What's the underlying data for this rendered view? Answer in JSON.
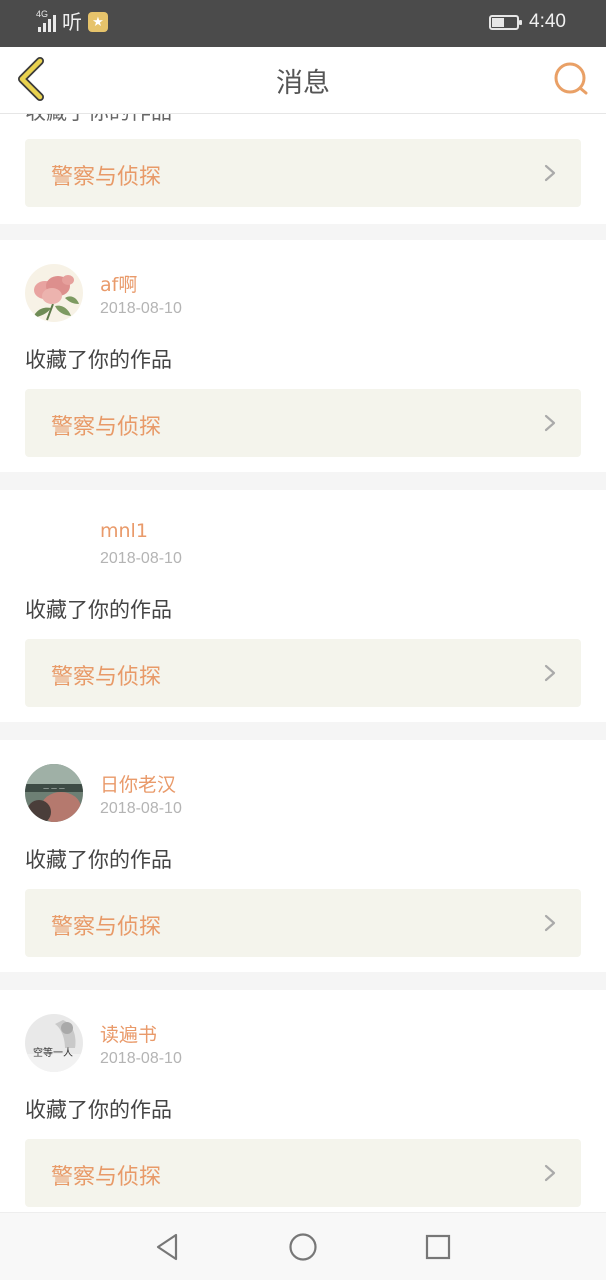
{
  "status_bar": {
    "network": "4G",
    "app_label": "听",
    "time": "4:40",
    "battery_level": 0.45,
    "icons": [
      "signal-icon",
      "ting-app-icon",
      "star-app-icon",
      "battery-icon"
    ]
  },
  "nav": {
    "title": "消息",
    "back_icon": "chevron-left-icon",
    "search_icon": "search-icon",
    "accent_color": "#e9a066",
    "back_color": "#e9d24f"
  },
  "partial_top": {
    "work_title": "警察与侦探"
  },
  "messages": [
    {
      "username": "af啊",
      "date": "2018-08-10",
      "action": "收藏了你的作品",
      "work_title": "警察与侦探",
      "avatar": "flower-avatar"
    },
    {
      "username": "mnl1",
      "date": "2018-08-10",
      "action": "收藏了你的作品",
      "work_title": "警察与侦探",
      "avatar": "blank-avatar"
    },
    {
      "username": "日你老汉",
      "date": "2018-08-10",
      "action": "收藏了你的作品",
      "work_title": "警察与侦探",
      "avatar": "photo-avatar"
    },
    {
      "username": "读遍书",
      "date": "2018-08-10",
      "action": "收藏了你的作品",
      "work_title": "警察与侦探",
      "avatar": "sketch-avatar",
      "avatar_text": "空等一人"
    }
  ],
  "colors": {
    "username": "#e99a6a",
    "work_title": "#e89a68",
    "work_bg": "#f4f4ec",
    "date": "#b4b4b4",
    "separator": "#f5f5f5"
  }
}
